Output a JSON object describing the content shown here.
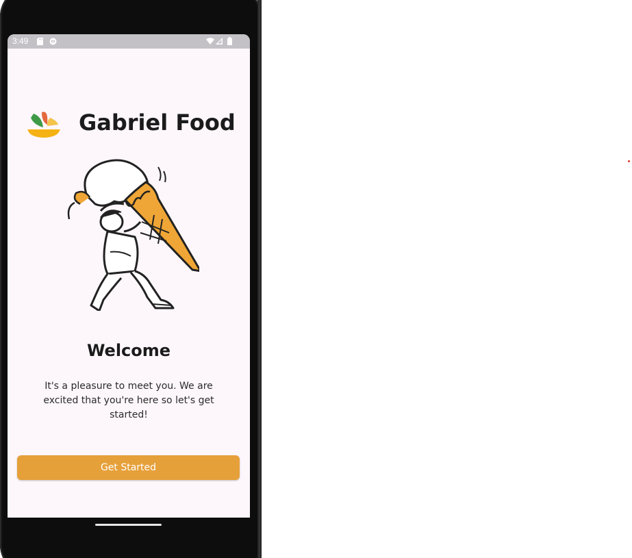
{
  "status_bar": {
    "time": "3:49",
    "icons": [
      "sd-card-icon",
      "notification-icon",
      "wifi-icon",
      "signal-icon",
      "battery-icon"
    ]
  },
  "brand": {
    "name": "Gabriel Food",
    "logo_icon": "bowl-logo-icon"
  },
  "illustration": {
    "icon": "person-carrying-ice-cream-illustration"
  },
  "welcome": {
    "title": "Welcome",
    "body": "It's a pleasure to meet you. We are excited that you're here so let's get started!"
  },
  "cta": {
    "label": "Get Started"
  },
  "colors": {
    "accent": "#e6a03a",
    "screen_bg": "#fdf7fb",
    "status_bar_bg": "#c4c1c6",
    "text": "#1b1b1b"
  }
}
